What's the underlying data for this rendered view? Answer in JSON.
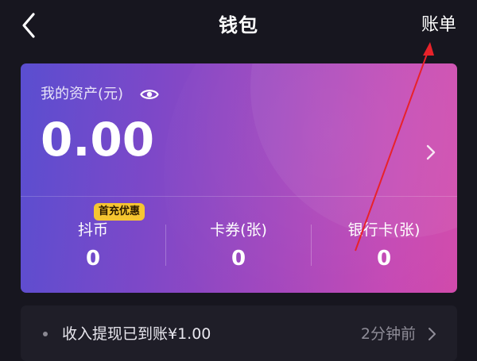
{
  "header": {
    "back_icon": "chevron-left-icon",
    "title": "钱包",
    "bill_label": "账单"
  },
  "card": {
    "asset_label": "我的资产(元)",
    "eye_icon": "eye-icon",
    "amount": "0.00",
    "chevron_icon": "chevron-right-icon",
    "stats": [
      {
        "label": "抖币",
        "value": "0",
        "badge": "首充优惠"
      },
      {
        "label": "卡券(张)",
        "value": "0"
      },
      {
        "label": "银行卡(张)",
        "value": "0"
      }
    ],
    "gradient_start": "#5a4ed0",
    "gradient_end": "#d14aab",
    "badge_color": "#f6c531"
  },
  "notice": {
    "text": "收入提现已到账¥1.00",
    "time": "2分钟前",
    "chevron_icon": "chevron-right-icon"
  },
  "annotation": {
    "type": "red-arrow",
    "color": "#e8222a",
    "points_to": "bill_label"
  },
  "colors": {
    "background": "#17161f",
    "notice_background": "#1f1e28"
  }
}
